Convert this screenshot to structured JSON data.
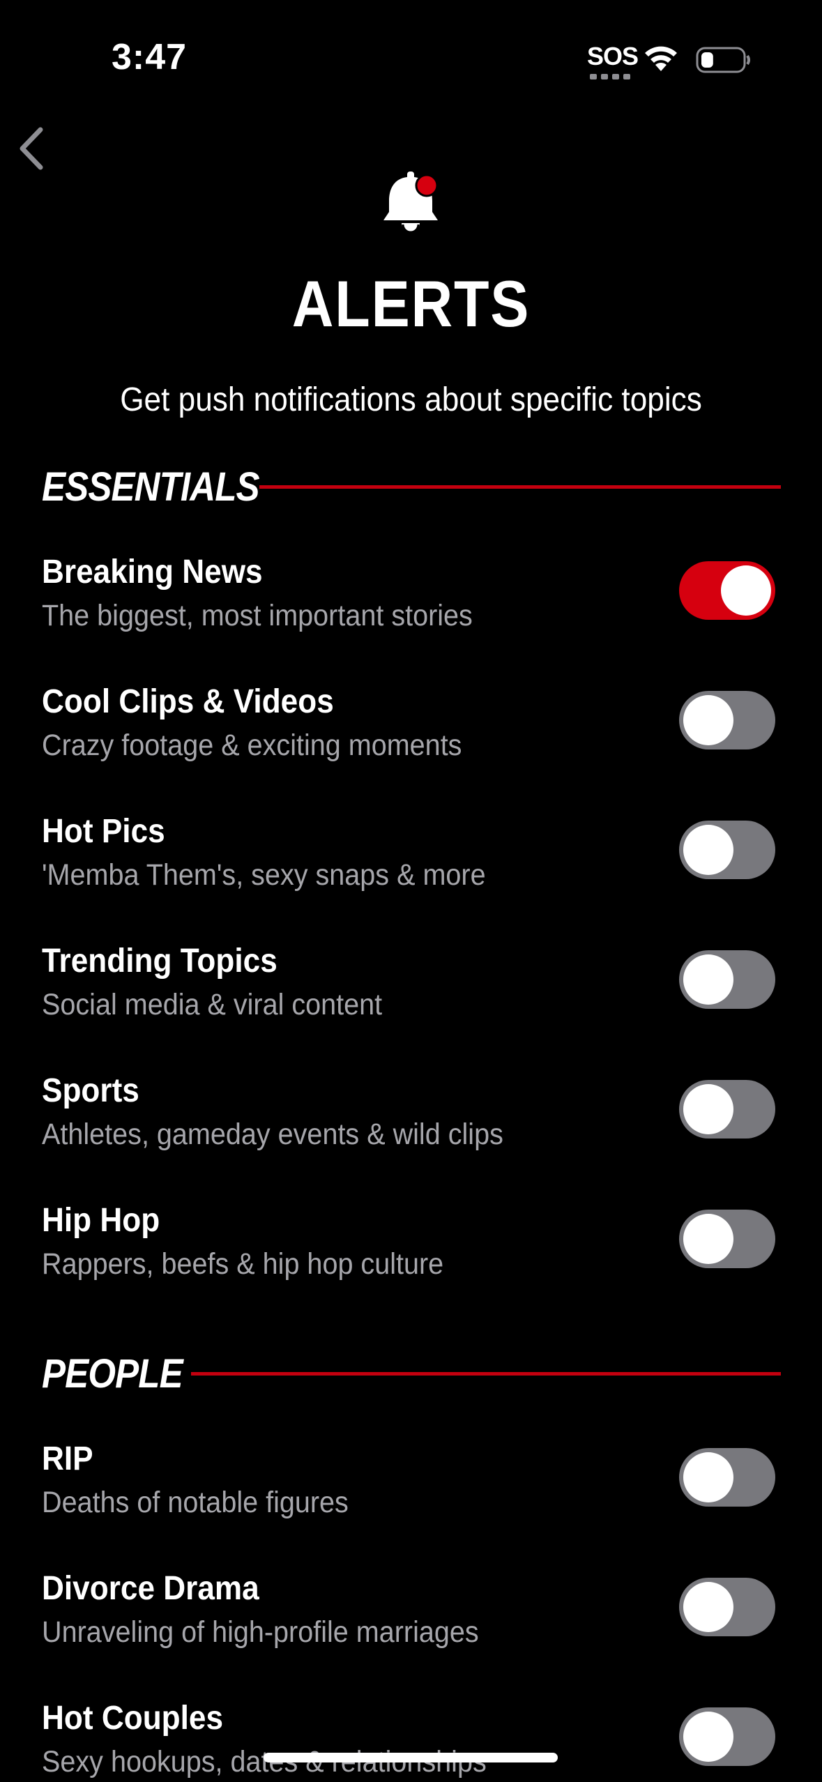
{
  "status_bar": {
    "time": "3:47",
    "sos": "SOS",
    "battery_level": 0.3
  },
  "header": {
    "title": "ALERTS",
    "subtitle": "Get push notifications about specific topics"
  },
  "sections": [
    {
      "title": "ESSENTIALS",
      "items": [
        {
          "title": "Breaking News",
          "description": "The biggest, most important stories",
          "enabled": true
        },
        {
          "title": "Cool Clips & Videos",
          "description": "Crazy footage & exciting moments",
          "enabled": false
        },
        {
          "title": "Hot Pics",
          "description": "'Memba Them's, sexy snaps & more",
          "enabled": false
        },
        {
          "title": "Trending Topics",
          "description": "Social media & viral content",
          "enabled": false
        },
        {
          "title": "Sports",
          "description": "Athletes, gameday events & wild clips",
          "enabled": false
        },
        {
          "title": "Hip Hop",
          "description": "Rappers, beefs & hip hop culture",
          "enabled": false
        }
      ]
    },
    {
      "title": "PEOPLE",
      "items": [
        {
          "title": "RIP",
          "description": "Deaths of notable figures",
          "enabled": false
        },
        {
          "title": "Divorce Drama",
          "description": "Unraveling of high-profile marriages",
          "enabled": false
        },
        {
          "title": "Hot Couples",
          "description": "Sexy hookups, dates & relationships",
          "enabled": false
        }
      ]
    }
  ],
  "colors": {
    "accent": "#d6000f",
    "section_line": "#c4000f",
    "toggle_off": "#78787d",
    "description": "#a6a6ab",
    "background": "#000000"
  }
}
